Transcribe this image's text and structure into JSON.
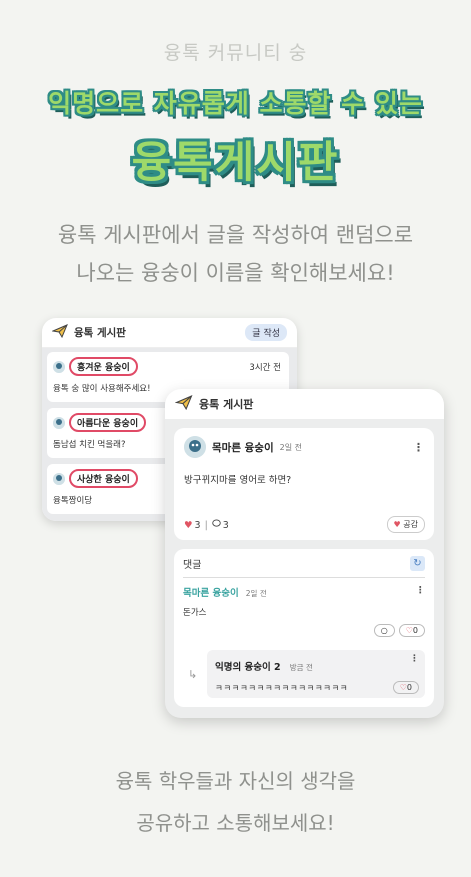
{
  "top_tag": "융톡 커뮤니티 숭",
  "headline1": "익명으로 자유롭게 소통할 수 있는",
  "headline2": "융톡게시판",
  "desc_line1": "융톡 게시판에서 글을 작성하여 랜덤으로",
  "desc_line2": "나오는 융숭이 이름을 확인해보세요!",
  "board_list": {
    "title": "융톡 게시판",
    "write_label": "글 작성",
    "posts": [
      {
        "name": "흥겨운 융숭이",
        "time": "3시간 전",
        "text": "융톡 숭 많이 사용해주세요!"
      },
      {
        "name": "아름다운 융숭이",
        "time": "",
        "text": "돔남섭 치킨 먹을래?"
      },
      {
        "name": "사상한 융숭이",
        "time": "",
        "text": "융톡짱이당"
      }
    ]
  },
  "detail": {
    "title": "융톡 게시판",
    "author": "목마른 융숭이",
    "time": "2일 전",
    "text": "방구뀌지마를 영어로 하면?",
    "like_count": "3",
    "comment_count": "3",
    "empathy_label": "공감",
    "comments_label": "댓글",
    "comment": {
      "name": "목마른 융숭이",
      "time": "2일 전",
      "text": "돈가스",
      "likes": "0"
    },
    "reply": {
      "name": "익명의 융숭이 2",
      "time": "방금 전",
      "text": "ㅋㅋㅋㅋㅋㅋㅋㅋㅋㅋㅋㅋㅋㅋㅋㅋ",
      "likes": "0"
    }
  },
  "bottom_line1": "융톡 학우들과 자신의 생각을",
  "bottom_line2": "공유하고 소통해보세요!",
  "colors": {
    "accent_green": "#9ed96a",
    "outline_teal": "#2f8c86",
    "highlight_red": "#e04a66",
    "name_teal": "#3aa3a0"
  }
}
